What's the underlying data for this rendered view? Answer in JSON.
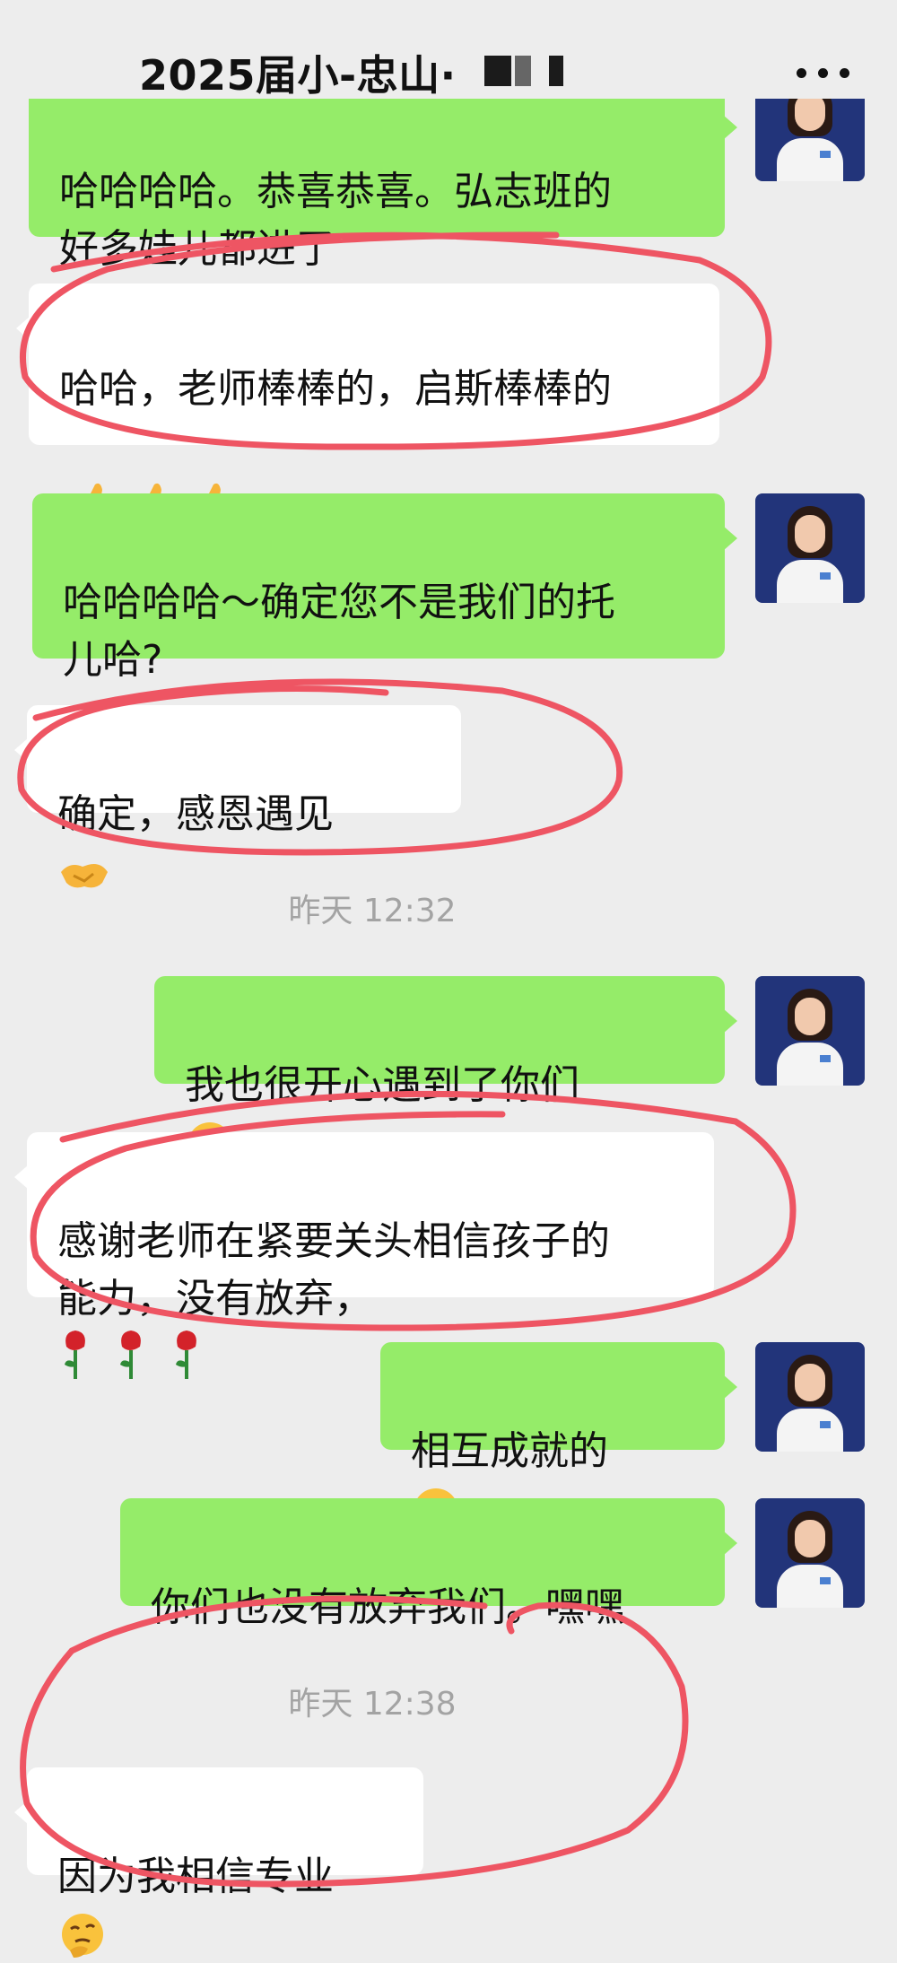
{
  "header": {
    "title": "2025届小-忠山·"
  },
  "messages": {
    "m1": "哈哈哈哈。恭喜恭喜。弘志班的\n好多娃儿都进了",
    "m2": "哈哈，老师棒棒的，启斯棒棒的",
    "m3": "哈哈哈哈～确定您不是我们的托\n儿哈?",
    "m4": "确定，感恩遇见",
    "m5": "我也很开心遇到了你们",
    "m6": "感谢老师在紧要关头相信孩子的\n能力，没有放弃，",
    "m7": "相互成就的",
    "m8": "你们也没有放弃我们。嘿嘿",
    "m9": "因为我相信专业"
  },
  "timestamps": {
    "t1": "昨天 12:32",
    "t2": "昨天 12:38"
  },
  "colors": {
    "bg": "#ededed",
    "bubble_right": "#95ec69",
    "bubble_left": "#ffffff",
    "annotation": "#ee5563"
  }
}
